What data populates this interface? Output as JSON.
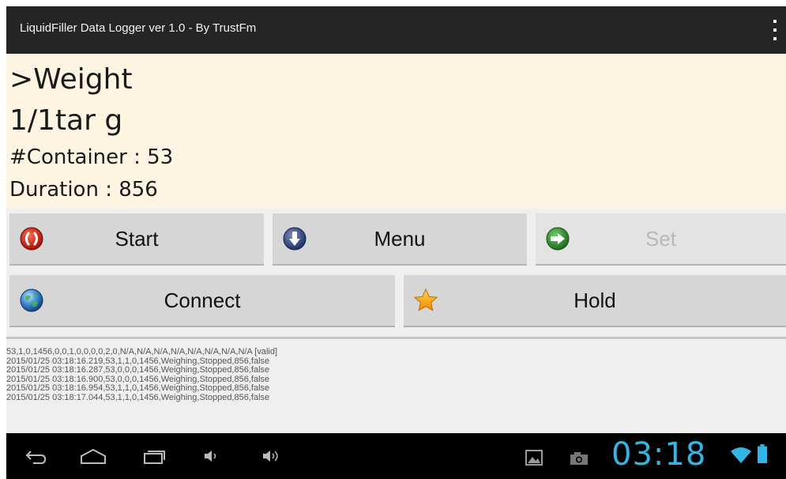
{
  "app": {
    "title": "LiquidFiller Data Logger ver 1.0 - By TrustFm",
    "overflow_icon": "overflow-menu-icon"
  },
  "display": {
    "line1": ">Weight",
    "line2": "1/1tar g",
    "line3": "#Container : 53",
    "line4": "Duration : 856",
    "background": "#fdf5e2"
  },
  "buttons": {
    "start": {
      "label": "Start",
      "icon": "stop-icon"
    },
    "menu": {
      "label": "Menu",
      "icon": "download-arrow-icon"
    },
    "set": {
      "label": "Set",
      "icon": "forward-arrow-icon",
      "enabled": false
    },
    "connect": {
      "label": "Connect",
      "icon": "globe-icon"
    },
    "hold": {
      "label": "Hold",
      "icon": "star-icon"
    }
  },
  "log": [
    "53,1,0,1456,0,0,1,0,0,0,0,2,0,N/A,N/A,N/A,N/A,N/A,N/A,N/A,N/A [valid]",
    "2015/01/25 03:18:16.219,53,1,1,0,1456,Weighing,Stopped,856,false",
    "2015/01/25 03:18:16.287,53,0,0,0,1456,Weighing,Stopped,856,false",
    "2015/01/25 03:18:16.900,53,0,0,0,1456,Weighing,Stopped,856,false",
    "2015/01/25 03:18:16.954,53,1,1,0,1456,Weighing,Stopped,856,false",
    "2015/01/25 03:18:17.044,53,1,1,0,1456,Weighing,Stopped,856,false"
  ],
  "system_bar": {
    "nav_icons": [
      "back-icon",
      "home-icon",
      "recent-apps-icon",
      "volume-down-icon",
      "volume-up-icon"
    ],
    "notification_icons": [
      "gallery-icon",
      "camera-icon"
    ],
    "clock": "03:18",
    "status_icons": [
      "wifi-icon",
      "battery-icon"
    ],
    "accent_color": "#33b5e5"
  }
}
